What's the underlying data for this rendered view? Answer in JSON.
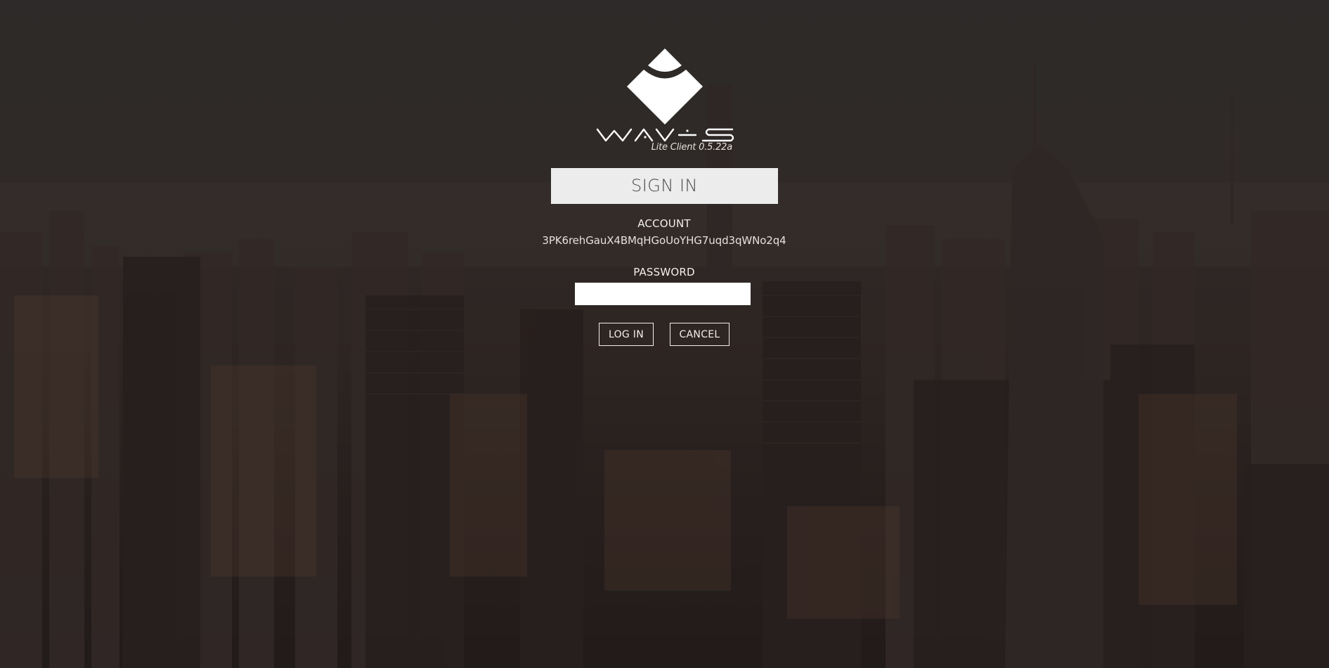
{
  "app": {
    "logo_name": "waves-logo",
    "version": "Lite Client 0.5.22a"
  },
  "signin": {
    "heading": "SIGN IN",
    "account_label": "ACCOUNT",
    "account_value": "3PK6rehGauX4BMqHGoUoYHG7uqd3qWNo2q4",
    "password_label": "PASSWORD",
    "password_value": "",
    "password_placeholder": ""
  },
  "actions": {
    "login_label": "LOG IN",
    "cancel_label": "CANCEL"
  },
  "colors": {
    "heading_bg": "#ececec",
    "heading_text": "#4a4a4a",
    "text_light": "#f2efea",
    "input_bg": "#ffffff"
  }
}
